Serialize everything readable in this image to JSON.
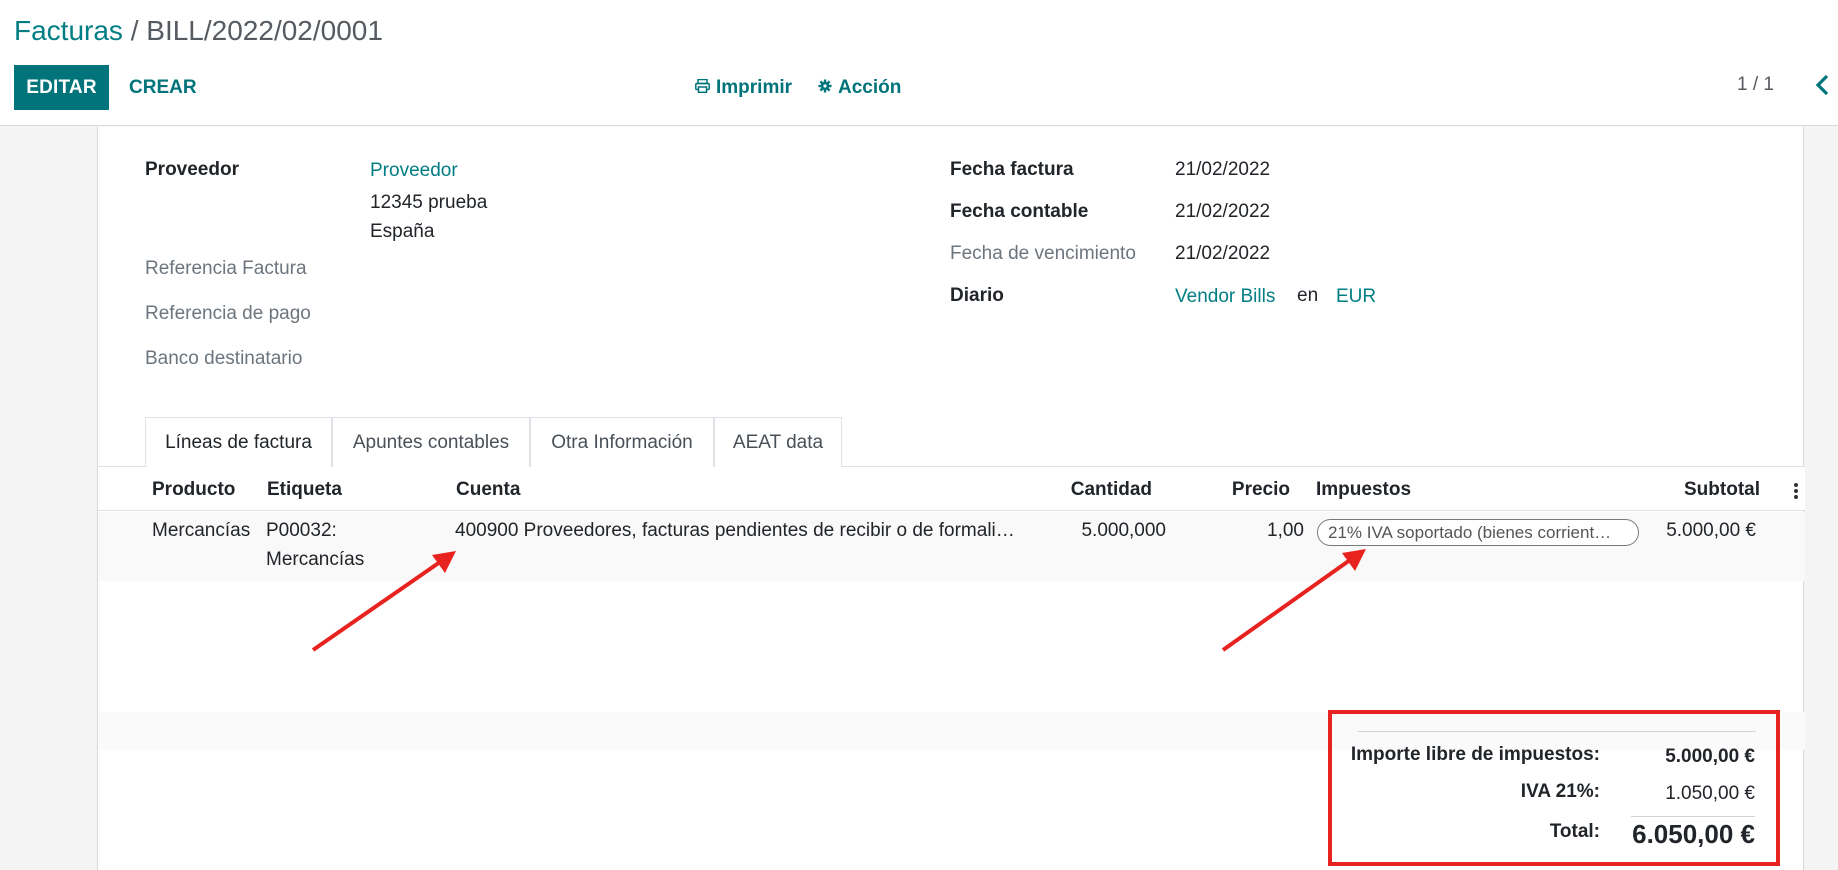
{
  "breadcrumb": {
    "parent": "Facturas",
    "separator": " / ",
    "current": "BILL/2022/02/0001"
  },
  "toolbar": {
    "edit_label": "EDITAR",
    "create_label": "CREAR",
    "print_label": "Imprimir",
    "action_label": "Acción"
  },
  "pager": {
    "value": "1 / 1"
  },
  "form": {
    "left": {
      "vendor_label": "Proveedor",
      "vendor_name": "Proveedor",
      "vendor_address_line1": "12345 prueba",
      "vendor_address_line2": "España",
      "invoice_ref_label": "Referencia Factura",
      "payment_ref_label": "Referencia de pago",
      "bank_label": "Banco destinatario"
    },
    "right": {
      "invoice_date_label": "Fecha factura",
      "invoice_date": "21/02/2022",
      "accounting_date_label": "Fecha contable",
      "accounting_date": "21/02/2022",
      "due_date_label": "Fecha de vencimiento",
      "due_date": "21/02/2022",
      "journal_label": "Diario",
      "journal": "Vendor Bills",
      "journal_in": "en",
      "currency": "EUR"
    }
  },
  "tabs": [
    {
      "label": "Líneas de factura",
      "active": true
    },
    {
      "label": "Apuntes contables",
      "active": false
    },
    {
      "label": "Otra Información",
      "active": false
    },
    {
      "label": "AEAT data",
      "active": false
    }
  ],
  "lines": {
    "columns": {
      "product": "Producto",
      "label": "Etiqueta",
      "account": "Cuenta",
      "quantity": "Cantidad",
      "price": "Precio",
      "taxes": "Impuestos",
      "subtotal": "Subtotal"
    },
    "rows": [
      {
        "product": "Mercancías",
        "label_line1": "P00032:",
        "label_line2": "Mercancías",
        "account": "400900 Proveedores, facturas pendientes de recibir o de formali…",
        "quantity": "5.000,000",
        "price": "1,00",
        "tax": "21% IVA soportado (bienes corrient…",
        "subtotal": "5.000,00 €"
      }
    ]
  },
  "totals": {
    "untaxed_label": "Importe libre de impuestos:",
    "untaxed_value": "5.000,00 €",
    "tax_label": "IVA 21%:",
    "tax_value": "1.050,00 €",
    "total_label": "Total:",
    "total_value": "6.050,00 €"
  },
  "colors": {
    "brand": "#00747a",
    "link": "#017e84",
    "annotation": "#e8231f"
  },
  "icons": {
    "print": "printer-icon",
    "action": "gear-icon",
    "pager_prev": "chevron-left-icon",
    "column_options": "kebab-menu-icon"
  }
}
